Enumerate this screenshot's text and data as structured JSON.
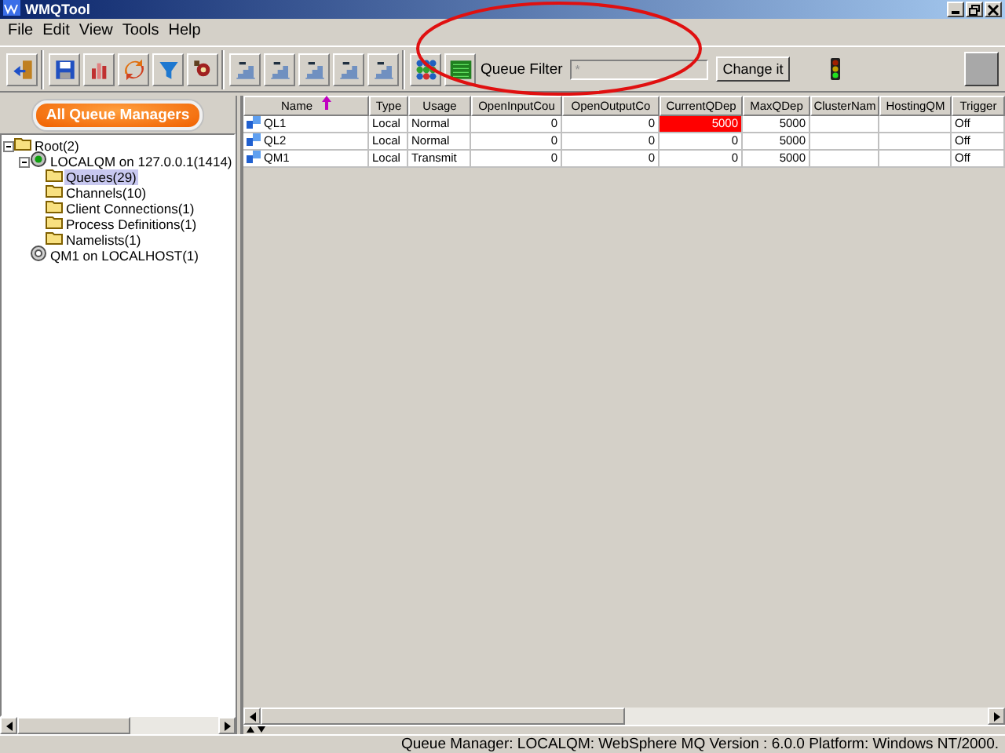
{
  "window": {
    "title": "WMQTool"
  },
  "menu": [
    "File",
    "Edit",
    "View",
    "Tools",
    "Help"
  ],
  "queue_filter": {
    "label": "Queue Filter",
    "value": "*",
    "button": "Change it"
  },
  "sidebar": {
    "button": "All Queue Managers",
    "tree": [
      {
        "label": "Root(2)",
        "expanded": true,
        "selected": false,
        "kind": "folder",
        "children": [
          {
            "label": "LOCALQM on 127.0.0.1(1414)",
            "expanded": true,
            "selected": false,
            "kind": "manager-running",
            "children": [
              {
                "label": "Queues(29)",
                "selected": true,
                "kind": "folder"
              },
              {
                "label": "Channels(10)",
                "selected": false,
                "kind": "folder"
              },
              {
                "label": "Client Connections(1)",
                "selected": false,
                "kind": "folder"
              },
              {
                "label": "Process Definitions(1)",
                "selected": false,
                "kind": "folder"
              },
              {
                "label": "Namelists(1)",
                "selected": false,
                "kind": "folder"
              }
            ]
          },
          {
            "label": "QM1 on LOCALHOST(1)",
            "selected": false,
            "kind": "manager-stopped"
          }
        ]
      }
    ]
  },
  "table": {
    "columns": [
      {
        "label": "Name",
        "kind": "text",
        "sorted": true
      },
      {
        "label": "Type",
        "kind": "text",
        "sorted": false
      },
      {
        "label": "Usage",
        "kind": "text",
        "sorted": false
      },
      {
        "label": "OpenInputCou",
        "kind": "number",
        "sorted": false
      },
      {
        "label": "OpenOutputCo",
        "kind": "number",
        "sorted": false
      },
      {
        "label": "CurrentQDep",
        "kind": "number",
        "sorted": false
      },
      {
        "label": "MaxQDep",
        "kind": "number",
        "sorted": false
      },
      {
        "label": "ClusterNam",
        "kind": "text",
        "sorted": false
      },
      {
        "label": "HostingQM",
        "kind": "text",
        "sorted": false
      },
      {
        "label": "Trigger",
        "kind": "text",
        "sorted": false
      }
    ],
    "rows": [
      {
        "cells": [
          "QL1",
          "Local",
          "Normal",
          "0",
          "0",
          "5000",
          "5000",
          "",
          "",
          "Off"
        ],
        "alert": [
          false,
          false,
          false,
          false,
          false,
          true,
          false,
          false,
          false,
          false
        ]
      },
      {
        "cells": [
          "QL2",
          "Local",
          "Normal",
          "0",
          "0",
          "0",
          "5000",
          "",
          "",
          "Off"
        ],
        "alert": [
          false,
          false,
          false,
          false,
          false,
          false,
          false,
          false,
          false,
          false
        ]
      },
      {
        "cells": [
          "QM1",
          "Local",
          "Transmit",
          "0",
          "0",
          "0",
          "5000",
          "",
          "",
          "Off"
        ],
        "alert": [
          false,
          false,
          false,
          false,
          false,
          false,
          false,
          false,
          false,
          false
        ]
      }
    ]
  },
  "status_bar": "Queue Manager: LOCALQM: WebSphere MQ Version : 6.0.0 Platform: Windows NT/2000."
}
